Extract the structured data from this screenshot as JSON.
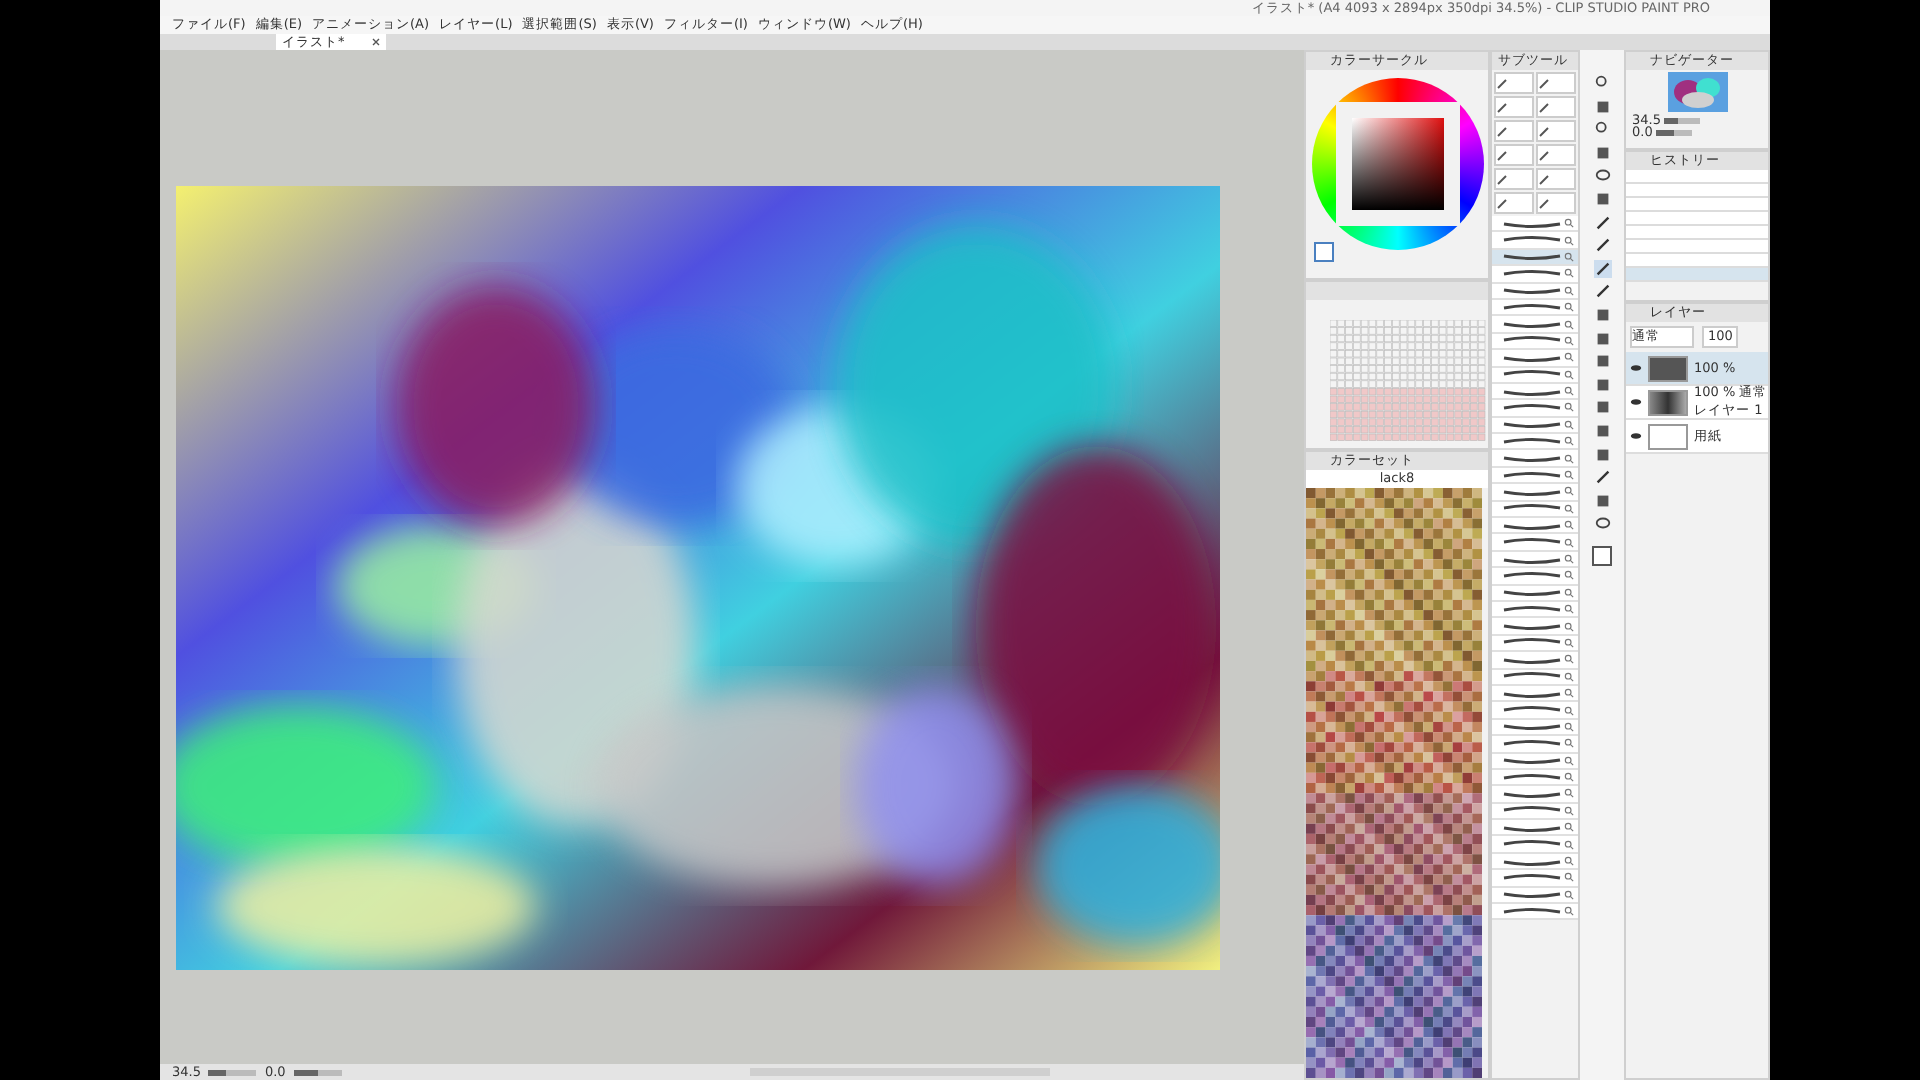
{
  "window": {
    "title": "イラスト* (A4 4093 x 2894px 350dpi 34.5%) - CLIP STUDIO PAINT PRO"
  },
  "menu": [
    "ファイル(F)",
    "編集(E)",
    "アニメーション(A)",
    "レイヤー(L)",
    "選択範囲(S)",
    "表示(V)",
    "フィルター(I)",
    "ウィンドウ(W)",
    "ヘルプ(H)"
  ],
  "tabs": [
    {
      "label": "イラスト*",
      "selected": true
    }
  ],
  "color_circle": {
    "title": "カラーサークル"
  },
  "color_set": {
    "title": "カラーセット",
    "set_name": "lack8"
  },
  "sub_tool": {
    "title": "サブツール",
    "brushes": [
      {
        "selected": false
      },
      {
        "selected": false
      },
      {
        "selected": true
      },
      {
        "selected": false
      },
      {
        "selected": false
      },
      {
        "selected": false
      },
      {
        "selected": false
      },
      {
        "selected": false
      },
      {
        "selected": false
      },
      {
        "selected": false
      },
      {
        "selected": false
      },
      {
        "selected": false
      },
      {
        "selected": false
      },
      {
        "selected": false
      },
      {
        "selected": false
      },
      {
        "selected": false
      },
      {
        "selected": false
      },
      {
        "selected": false
      },
      {
        "selected": false
      },
      {
        "selected": false
      },
      {
        "selected": false
      },
      {
        "selected": false
      },
      {
        "selected": false
      },
      {
        "selected": false
      },
      {
        "selected": false
      },
      {
        "selected": false
      },
      {
        "selected": false
      },
      {
        "selected": false
      },
      {
        "selected": false
      },
      {
        "selected": false
      },
      {
        "selected": false
      },
      {
        "selected": false
      },
      {
        "selected": false
      },
      {
        "selected": false
      },
      {
        "selected": false
      },
      {
        "selected": false
      },
      {
        "selected": false
      },
      {
        "selected": false
      },
      {
        "selected": false
      },
      {
        "selected": false
      },
      {
        "selected": false
      },
      {
        "selected": false
      }
    ]
  },
  "navigator": {
    "title": "ナビゲーター",
    "zoom": "34.5",
    "zoom_slider": {
      "level": 0.35
    },
    "angle": "0.0",
    "rotate_slider": {
      "level": 0.5
    }
  },
  "history": {
    "title": "ヒストリー",
    "items": [
      {
        "selected": false
      },
      {
        "selected": false
      },
      {
        "selected": false
      },
      {
        "selected": false
      },
      {
        "selected": false
      },
      {
        "selected": false
      },
      {
        "selected": false
      },
      {
        "selected": true
      }
    ]
  },
  "layers": {
    "title": "レイヤー",
    "blend_mode": "通常",
    "opacity": "100",
    "items": [
      {
        "kind": "raster",
        "label": "100 %",
        "selected": true
      },
      {
        "kind": "raster",
        "label": "100 % 通常",
        "name": "レイヤー 1",
        "selected": false
      },
      {
        "kind": "paper",
        "name": "用紙",
        "selected": false
      }
    ]
  },
  "status": {
    "zoom": "34.5",
    "zoom_slider": {
      "level": 0.35
    },
    "angle": "0.0",
    "rotate_slider": {
      "level": 0.5
    }
  }
}
